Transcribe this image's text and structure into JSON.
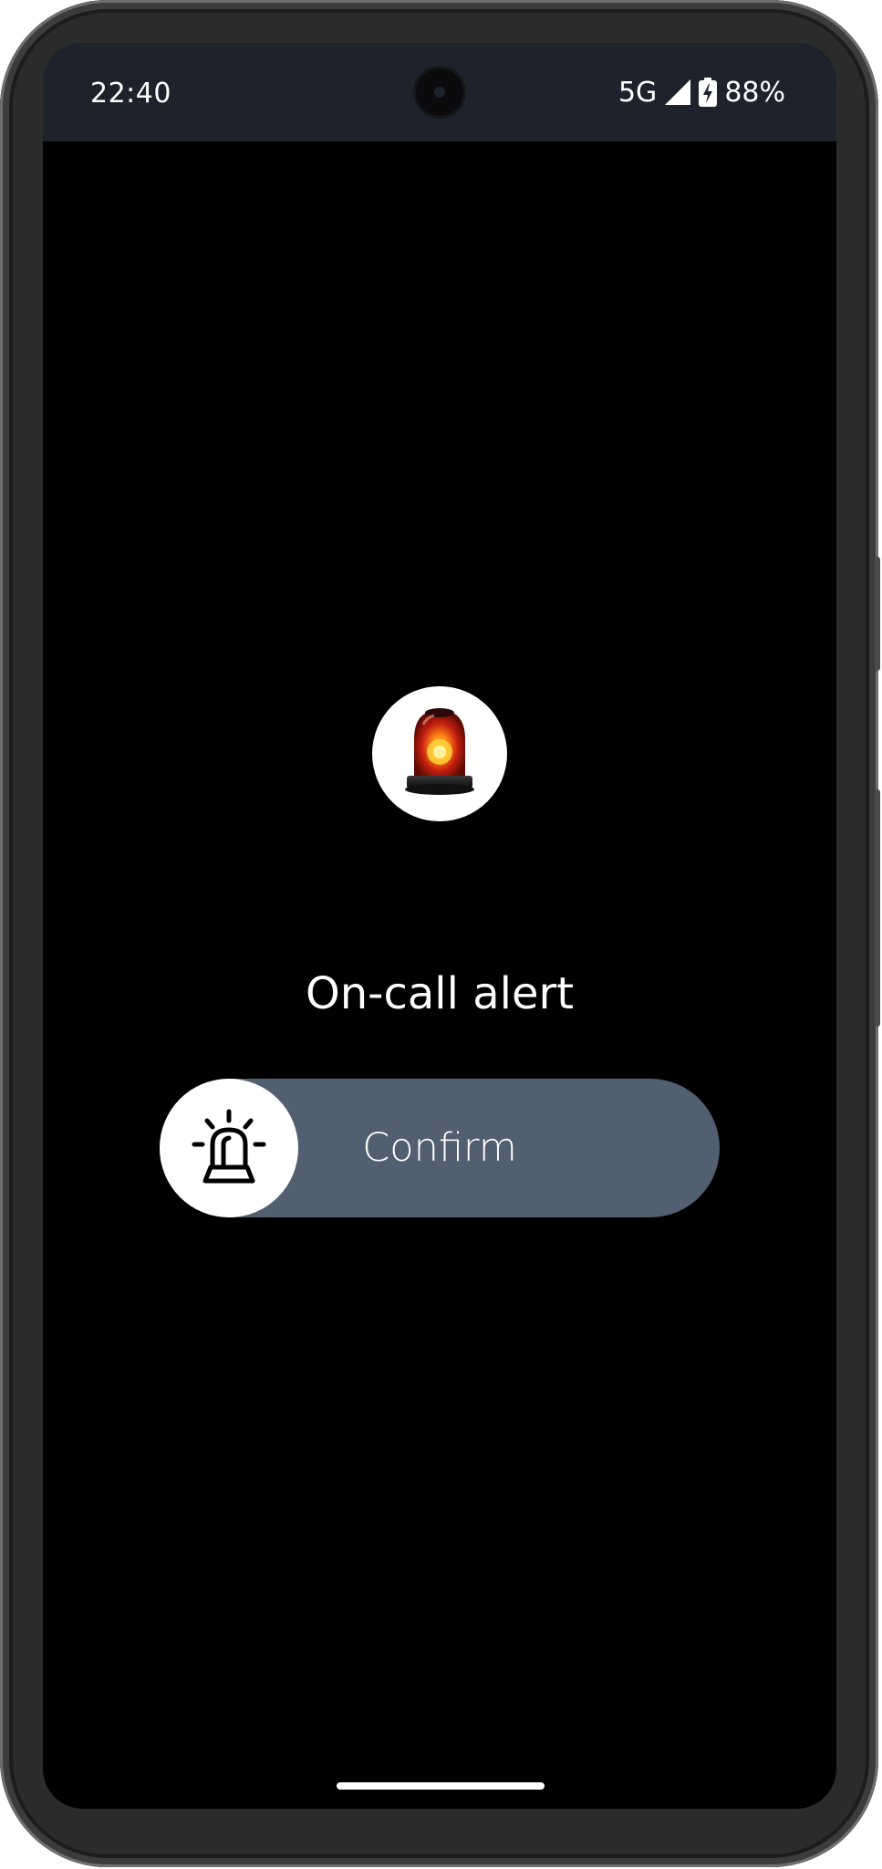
{
  "status_bar": {
    "time": "22:40",
    "network": "5G",
    "battery": "88%",
    "icons": [
      "signal-icon",
      "battery-charging-icon"
    ]
  },
  "alert": {
    "icon": "siren-icon",
    "title": "On-call alert"
  },
  "slider": {
    "label": "Confirm",
    "knob_icon": "siren-outline-icon"
  },
  "colors": {
    "status_bar_bg": "#1d222c",
    "screen_bg": "#000000",
    "slider_bg": "#515f70",
    "knob_bg": "#ffffff",
    "text": "#ffffff"
  }
}
